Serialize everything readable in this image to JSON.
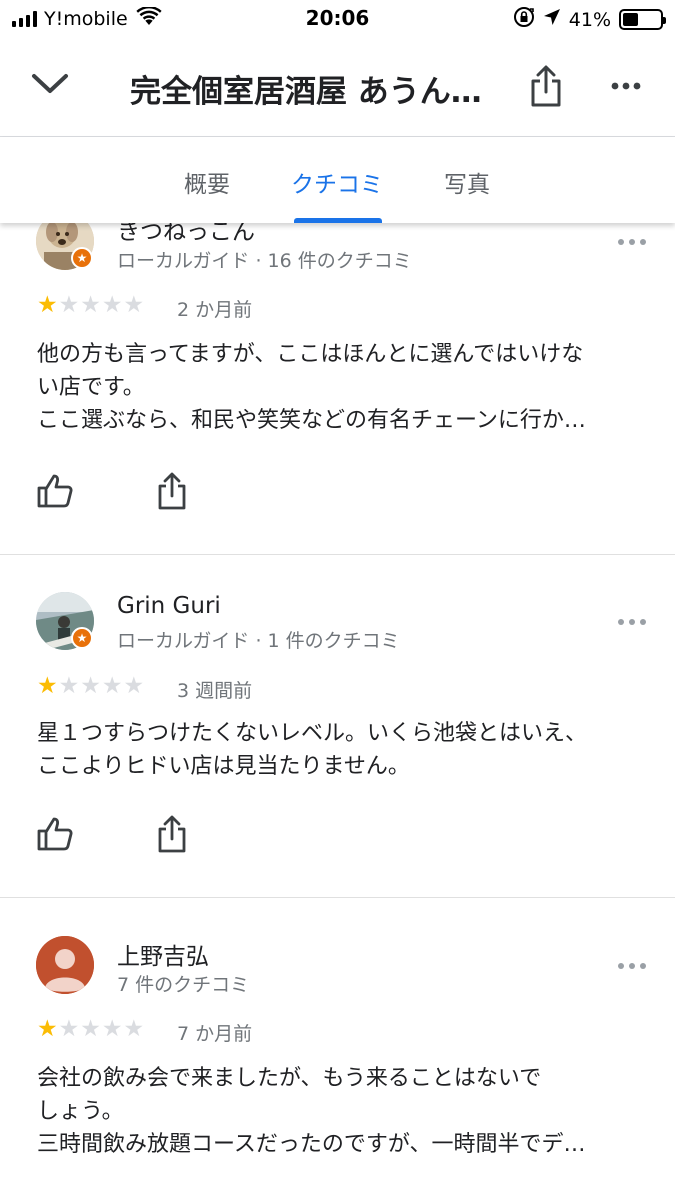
{
  "status_bar": {
    "carrier": "Y!mobile",
    "time": "20:06",
    "battery": "41%",
    "battery_level": 0.41
  },
  "header": {
    "title": "完全個室居酒屋 あうん…",
    "icons": [
      "chevron-down-icon",
      "share-icon",
      "more-horiz-icon"
    ]
  },
  "tabs": [
    {
      "label": "概要",
      "active": false
    },
    {
      "label": "クチコミ",
      "active": true
    },
    {
      "label": "写真",
      "active": false
    }
  ],
  "colors": {
    "accent": "#1a73e8",
    "star_on": "#fbbc04",
    "star_off": "#dadce0",
    "local_guide_badge": "#e8710a",
    "avatar_default": "#c1502e"
  },
  "reviews": [
    {
      "name": "きつねっこん",
      "meta": "ローカルガイド · 16 件のクチコミ",
      "rating": 1,
      "date": "2 か月前",
      "lines": [
        "他の方も言ってますが、ここはほんとに選んではいけな",
        "い店です。",
        "ここ選ぶなら、和民や笑笑などの有名チェーンに行か…"
      ]
    },
    {
      "name": "Grin Guri",
      "meta": "ローカルガイド · 1 件のクチコミ",
      "rating": 1,
      "date": "3 週間前",
      "lines": [
        "星１つすらつけたくないレベル。いくら池袋とはいえ、",
        "ここよりヒドい店は見当たりません。"
      ]
    },
    {
      "name": "上野吉弘",
      "meta": "7 件のクチコミ",
      "rating": 1,
      "date": "7 か月前",
      "lines": [
        "会社の飲み会で来ましたが、もう来ることはないで",
        "しょう。",
        "三時間飲み放題コースだったのですが、一時間半でデ…"
      ]
    }
  ]
}
